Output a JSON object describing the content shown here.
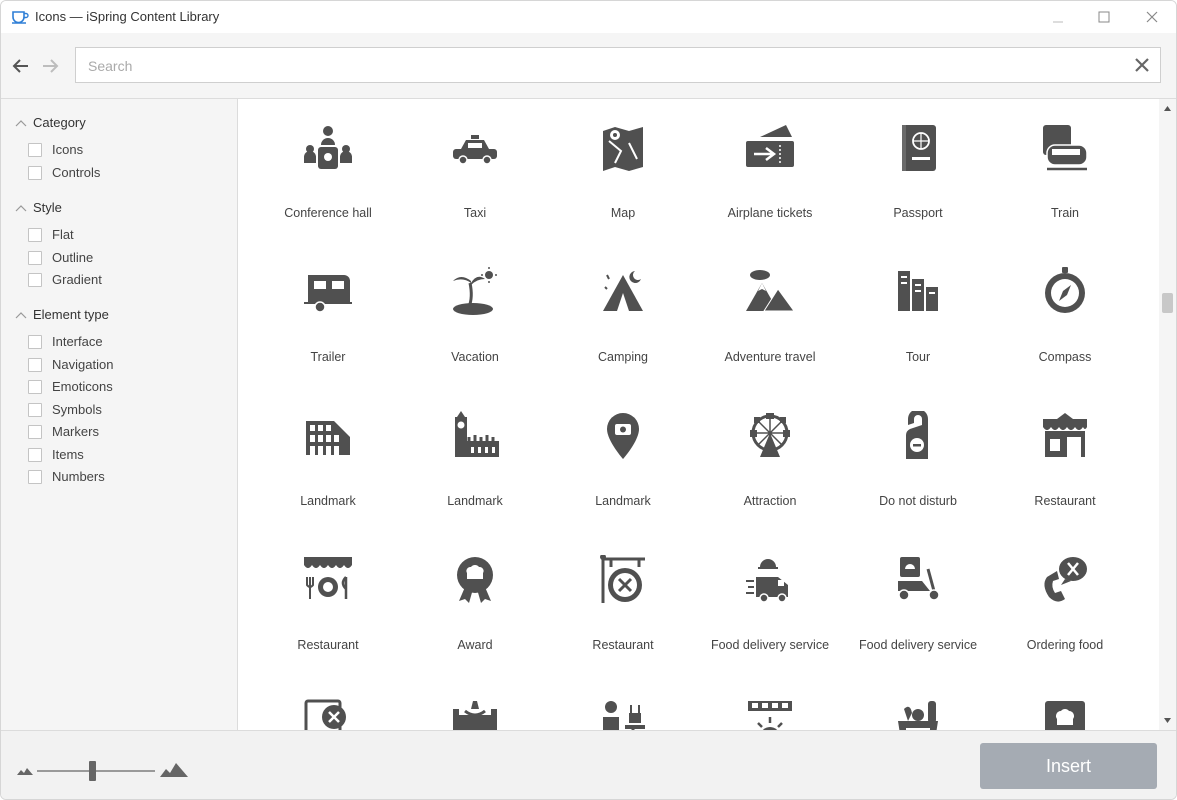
{
  "window": {
    "title": "Icons — iSpring Content Library"
  },
  "search": {
    "placeholder": "Search",
    "value": ""
  },
  "sidebar": {
    "groups": [
      {
        "title": "Category",
        "options": [
          "Icons",
          "Controls"
        ]
      },
      {
        "title": "Style",
        "options": [
          "Flat",
          "Outline",
          "Gradient"
        ]
      },
      {
        "title": "Element type",
        "options": [
          "Interface",
          "Navigation",
          "Emoticons",
          "Symbols",
          "Markers",
          "Items",
          "Numbers"
        ]
      }
    ]
  },
  "icons": [
    {
      "label": "Conference hall",
      "icon": "conference-hall-icon"
    },
    {
      "label": "Taxi",
      "icon": "taxi-icon"
    },
    {
      "label": "Map",
      "icon": "map-icon"
    },
    {
      "label": "Airplane tickets",
      "icon": "airplane-tickets-icon"
    },
    {
      "label": "Passport",
      "icon": "passport-icon"
    },
    {
      "label": "Train",
      "icon": "train-icon"
    },
    {
      "label": "Trailer",
      "icon": "trailer-icon"
    },
    {
      "label": "Vacation",
      "icon": "vacation-icon"
    },
    {
      "label": "Camping",
      "icon": "camping-icon"
    },
    {
      "label": "Adventure travel",
      "icon": "adventure-travel-icon"
    },
    {
      "label": "Tour",
      "icon": "tour-icon"
    },
    {
      "label": "Compass",
      "icon": "compass-icon"
    },
    {
      "label": "Landmark",
      "icon": "colosseum-landmark-icon"
    },
    {
      "label": "Landmark",
      "icon": "big-ben-landmark-icon"
    },
    {
      "label": "Landmark",
      "icon": "location-pin-landmark-icon"
    },
    {
      "label": "Attraction",
      "icon": "ferris-wheel-icon"
    },
    {
      "label": "Do not disturb",
      "icon": "door-hanger-icon"
    },
    {
      "label": "Restaurant",
      "icon": "restaurant-building-icon"
    },
    {
      "label": "Restaurant",
      "icon": "restaurant-awning-icon"
    },
    {
      "label": "Award",
      "icon": "award-icon"
    },
    {
      "label": "Restaurant",
      "icon": "restaurant-sign-icon"
    },
    {
      "label": "Food delivery service",
      "icon": "delivery-van-icon"
    },
    {
      "label": "Food delivery service",
      "icon": "delivery-scooter-icon"
    },
    {
      "label": "Ordering food",
      "icon": "ordering-food-icon"
    },
    {
      "label": "",
      "icon": "menu-board-icon"
    },
    {
      "label": "",
      "icon": "dining-table-icon"
    },
    {
      "label": "",
      "icon": "waiter-icon"
    },
    {
      "label": "",
      "icon": "sunset-icon"
    },
    {
      "label": "",
      "icon": "groceries-icon"
    },
    {
      "label": "",
      "icon": "chef-board-icon"
    }
  ],
  "zoom": {
    "level": 0.47
  },
  "footer": {
    "insert_label": "Insert"
  },
  "colors": {
    "icon": "#505050",
    "insert_button": "#a5abb3"
  }
}
